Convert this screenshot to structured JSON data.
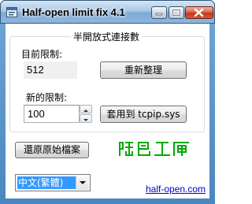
{
  "window": {
    "title": "Half-open limit fix 4.1",
    "icon": "app-icon"
  },
  "group": {
    "title": "半開放式連接數"
  },
  "current": {
    "label": "目前限制:",
    "value": "512",
    "refresh_button": "重新整理"
  },
  "new_limit": {
    "label": "新的限制:",
    "value": "100",
    "apply_button": "套用到 tcpip.sys"
  },
  "restore_button": "還原原始檔案",
  "logo_text": "綠色工廠",
  "language": {
    "selected": "中文(繁體)"
  },
  "link": "half-open.com",
  "colors": {
    "logo_green": "#00aa00",
    "selection_blue": "#3399ff",
    "link_blue": "#0000cc"
  }
}
